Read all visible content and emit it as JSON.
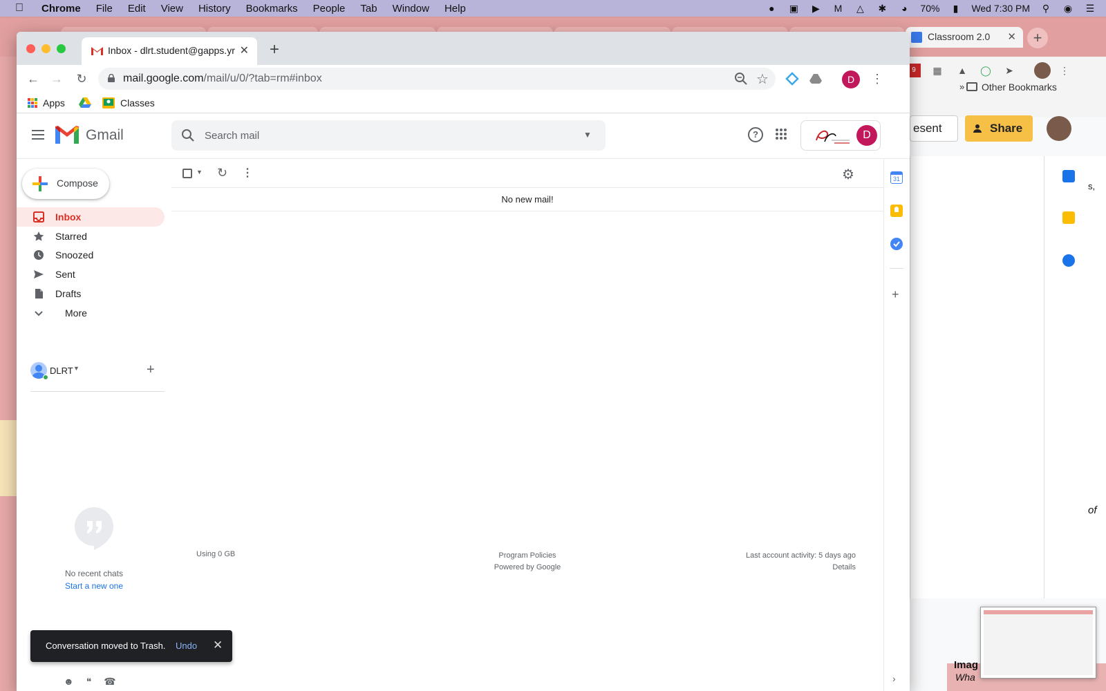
{
  "macos_menubar": {
    "app_name": "Chrome",
    "menus": [
      "File",
      "Edit",
      "View",
      "History",
      "Bookmarks",
      "People",
      "Tab",
      "Window",
      "Help"
    ],
    "battery": "70%",
    "clock": "Wed 7:30 PM"
  },
  "background_window": {
    "visible_tab_title": "Classroom 2.0",
    "other_bookmarks": "Other Bookmarks",
    "bookmarks_overflow": "»",
    "present_button": "esent",
    "share_button": "Share",
    "notification_count": "9",
    "doc_text_fragments": [
      "Imag",
      "Wha",
      "of",
      "s,"
    ]
  },
  "browser": {
    "tab_title": "Inbox - dlrt.student@gapps.yrdsb",
    "url_host": "mail.google.com",
    "url_path": "/mail/u/0/?tab=rm#inbox",
    "profile_initial": "D",
    "bookmarks": [
      "Apps",
      "Classes"
    ]
  },
  "gmail": {
    "product_name": "Gmail",
    "search_placeholder": "Search mail",
    "account_initial": "D",
    "compose_label": "Compose",
    "nav": [
      {
        "label": "Inbox",
        "icon": "inbox-icon",
        "active": true
      },
      {
        "label": "Starred",
        "icon": "star-icon"
      },
      {
        "label": "Snoozed",
        "icon": "clock-icon"
      },
      {
        "label": "Sent",
        "icon": "send-icon"
      },
      {
        "label": "Drafts",
        "icon": "draft-icon"
      },
      {
        "label": "More",
        "icon": "chevron-down-icon"
      }
    ],
    "hangouts_user": "DLRT",
    "no_chats": "No recent chats",
    "start_chat": "Start a new one",
    "empty_message": "No new mail!",
    "footer": {
      "storage": "Using 0 GB",
      "policies": "Program Policies",
      "powered": "Powered by Google",
      "activity": "Last account activity: 5 days ago",
      "details": "Details"
    },
    "side_icons": [
      "calendar-icon",
      "keep-icon",
      "tasks-icon"
    ],
    "calendar_day": "31"
  },
  "snackbar": {
    "message": "Conversation moved to Trash.",
    "action": "Undo"
  },
  "colors": {
    "gmail_red": "#d93025",
    "inbox_highlight": "#fce8e6",
    "link_blue": "#1a73e8",
    "profile_magenta": "#c2185b"
  }
}
